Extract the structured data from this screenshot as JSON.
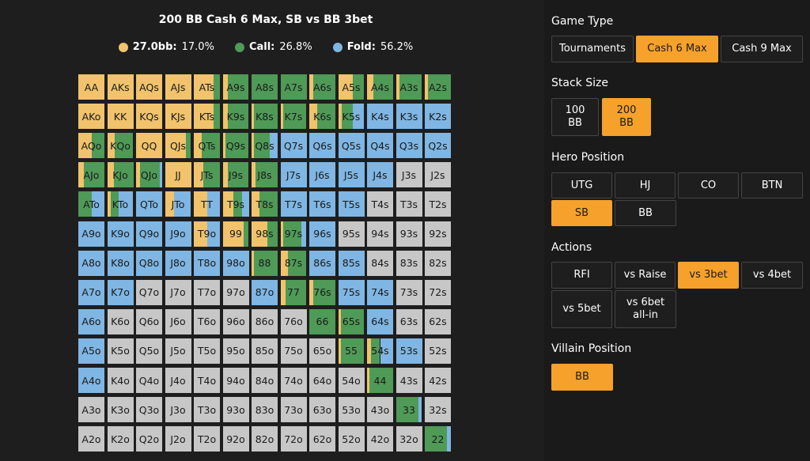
{
  "colors": {
    "raise": "#f0c36c",
    "call": "#4f9a57",
    "fold": "#7fb6e3",
    "none": "#c7c7c7",
    "accent": "#f5a12b"
  },
  "chart": {
    "title": "200 BB Cash 6 Max, SB vs BB 3bet",
    "legend": [
      {
        "label": "27.0bb:",
        "value": "17.0%",
        "color": "#f0c36c"
      },
      {
        "label": "Call:",
        "value": "26.8%",
        "color": "#4f9a57"
      },
      {
        "label": "Fold:",
        "value": "56.2%",
        "color": "#7fb6e3"
      }
    ]
  },
  "hands": [
    [
      "AA",
      "AKs",
      "AQs",
      "AJs",
      "ATs",
      "A9s",
      "A8s",
      "A7s",
      "A6s",
      "A5s",
      "A4s",
      "A3s",
      "A2s"
    ],
    [
      "AKo",
      "KK",
      "KQs",
      "KJs",
      "KTs",
      "K9s",
      "K8s",
      "K7s",
      "K6s",
      "K5s",
      "K4s",
      "K3s",
      "K2s"
    ],
    [
      "AQo",
      "KQo",
      "QQ",
      "QJs",
      "QTs",
      "Q9s",
      "Q8s",
      "Q7s",
      "Q6s",
      "Q5s",
      "Q4s",
      "Q3s",
      "Q2s"
    ],
    [
      "AJo",
      "KJo",
      "QJo",
      "JJ",
      "JTs",
      "J9s",
      "J8s",
      "J7s",
      "J6s",
      "J5s",
      "J4s",
      "J3s",
      "J2s"
    ],
    [
      "ATo",
      "KTo",
      "QTo",
      "JTo",
      "TT",
      "T9s",
      "T8s",
      "T7s",
      "T6s",
      "T5s",
      "T4s",
      "T3s",
      "T2s"
    ],
    [
      "A9o",
      "K9o",
      "Q9o",
      "J9o",
      "T9o",
      "99",
      "98s",
      "97s",
      "96s",
      "95s",
      "94s",
      "93s",
      "92s"
    ],
    [
      "A8o",
      "K8o",
      "Q8o",
      "J8o",
      "T8o",
      "98o",
      "88",
      "87s",
      "86s",
      "85s",
      "84s",
      "83s",
      "82s"
    ],
    [
      "A7o",
      "K7o",
      "Q7o",
      "J7o",
      "T7o",
      "97o",
      "87o",
      "77",
      "76s",
      "75s",
      "74s",
      "73s",
      "72s"
    ],
    [
      "A6o",
      "K6o",
      "Q6o",
      "J6o",
      "T6o",
      "96o",
      "86o",
      "76o",
      "66",
      "65s",
      "64s",
      "63s",
      "62s"
    ],
    [
      "A5o",
      "K5o",
      "Q5o",
      "J5o",
      "T5o",
      "95o",
      "85o",
      "75o",
      "65o",
      "55",
      "54s",
      "53s",
      "52s"
    ],
    [
      "A4o",
      "K4o",
      "Q4o",
      "J4o",
      "T4o",
      "94o",
      "84o",
      "74o",
      "64o",
      "54o",
      "44",
      "43s",
      "42s"
    ],
    [
      "A3o",
      "K3o",
      "Q3o",
      "J3o",
      "T3o",
      "93o",
      "83o",
      "73o",
      "63o",
      "53o",
      "43o",
      "33",
      "32s"
    ],
    [
      "A2o",
      "K2o",
      "Q2o",
      "J2o",
      "T2o",
      "92o",
      "82o",
      "72o",
      "62o",
      "52o",
      "42o",
      "32o",
      "22"
    ]
  ],
  "freqs": [
    [
      [
        1,
        0,
        0
      ],
      [
        1,
        0,
        0
      ],
      [
        1,
        0,
        0
      ],
      [
        1,
        0,
        0
      ],
      [
        0.75,
        0.25,
        0
      ],
      [
        0.2,
        0.8,
        0
      ],
      [
        0,
        1,
        0
      ],
      [
        0,
        1,
        0
      ],
      [
        0.15,
        0.85,
        0
      ],
      [
        0.55,
        0.45,
        0
      ],
      [
        0.25,
        0.75,
        0
      ],
      [
        0.15,
        0.85,
        0
      ],
      [
        0.12,
        0.88,
        0
      ]
    ],
    [
      [
        1,
        0,
        0
      ],
      [
        1,
        0,
        0
      ],
      [
        1,
        0,
        0
      ],
      [
        1,
        0,
        0
      ],
      [
        0.75,
        0.25,
        0
      ],
      [
        0.2,
        0.8,
        0
      ],
      [
        0.1,
        0.9,
        0
      ],
      [
        0.12,
        0.88,
        0
      ],
      [
        0.3,
        0.7,
        0
      ],
      [
        0.15,
        0.4,
        0.45
      ],
      [
        0,
        0,
        1
      ],
      [
        0,
        0,
        1
      ],
      [
        0,
        0,
        1
      ]
    ],
    [
      [
        0.5,
        0.5,
        0
      ],
      [
        0.3,
        0.7,
        0
      ],
      [
        1,
        0,
        0
      ],
      [
        0.8,
        0.2,
        0
      ],
      [
        0.3,
        0.7,
        0
      ],
      [
        0.1,
        0.9,
        0
      ],
      [
        0.1,
        0.6,
        0.3
      ],
      [
        0,
        0,
        1
      ],
      [
        0,
        0,
        1
      ],
      [
        0,
        0,
        1
      ],
      [
        0,
        0,
        1
      ],
      [
        0,
        0,
        1
      ],
      [
        0,
        0,
        1
      ]
    ],
    [
      [
        0.2,
        0.8,
        0
      ],
      [
        0.25,
        0.75,
        0
      ],
      [
        0.15,
        0.75,
        0.1
      ],
      [
        1,
        0,
        0
      ],
      [
        0.35,
        0.65,
        0
      ],
      [
        0.2,
        0.8,
        0
      ],
      [
        0.15,
        0.85,
        0
      ],
      [
        0,
        0,
        1
      ],
      [
        0,
        0,
        1
      ],
      [
        0,
        0,
        1
      ],
      [
        0,
        0,
        1
      ],
      [
        0,
        0,
        0
      ],
      [
        0,
        0,
        0
      ]
    ],
    [
      [
        0,
        0.5,
        0.5
      ],
      [
        0.15,
        0.3,
        0.55
      ],
      [
        0,
        0,
        1
      ],
      [
        0.35,
        0,
        0.65
      ],
      [
        0.5,
        0,
        0.5
      ],
      [
        0.4,
        0.35,
        0.25
      ],
      [
        0.3,
        0.7,
        0
      ],
      [
        0,
        0,
        1
      ],
      [
        0,
        0,
        1
      ],
      [
        0,
        0,
        1
      ],
      [
        0,
        0,
        0
      ],
      [
        0,
        0,
        0
      ],
      [
        0,
        0,
        0
      ]
    ],
    [
      [
        0,
        0,
        1
      ],
      [
        0,
        0,
        1
      ],
      [
        0,
        0,
        1
      ],
      [
        0,
        0,
        1
      ],
      [
        0.5,
        0,
        0.5
      ],
      [
        0.8,
        0.2,
        0
      ],
      [
        0.6,
        0.4,
        0
      ],
      [
        0.1,
        0.7,
        0.2
      ],
      [
        0,
        0,
        1
      ],
      [
        0,
        0,
        0
      ],
      [
        0,
        0,
        0
      ],
      [
        0,
        0,
        0
      ],
      [
        0,
        0,
        0
      ]
    ],
    [
      [
        0,
        0,
        1
      ],
      [
        0,
        0,
        1
      ],
      [
        0,
        0,
        1
      ],
      [
        0,
        0,
        1
      ],
      [
        0,
        0,
        1
      ],
      [
        0,
        0,
        1
      ],
      [
        0.1,
        0.9,
        0
      ],
      [
        0.3,
        0.7,
        0
      ],
      [
        0,
        0,
        1
      ],
      [
        0,
        0,
        1
      ],
      [
        0,
        0,
        0
      ],
      [
        0,
        0,
        0
      ],
      [
        0,
        0,
        0
      ]
    ],
    [
      [
        0,
        0,
        1
      ],
      [
        0,
        0,
        1
      ],
      [
        0,
        0,
        0
      ],
      [
        0,
        0,
        0
      ],
      [
        0,
        0,
        0
      ],
      [
        0,
        0,
        0
      ],
      [
        0,
        0,
        1
      ],
      [
        0.2,
        0.8,
        0
      ],
      [
        0.15,
        0.85,
        0
      ],
      [
        0,
        0,
        1
      ],
      [
        0,
        0,
        1
      ],
      [
        0,
        0,
        0
      ],
      [
        0,
        0,
        0
      ]
    ],
    [
      [
        0,
        0,
        1
      ],
      [
        0,
        0,
        0
      ],
      [
        0,
        0,
        0
      ],
      [
        0,
        0,
        0
      ],
      [
        0,
        0,
        0
      ],
      [
        0,
        0,
        0
      ],
      [
        0,
        0,
        0
      ],
      [
        0,
        0,
        0
      ],
      [
        0,
        1,
        0
      ],
      [
        0.1,
        0.9,
        0
      ],
      [
        0,
        0,
        1
      ],
      [
        0,
        0,
        0
      ],
      [
        0,
        0,
        0
      ]
    ],
    [
      [
        0,
        0,
        1
      ],
      [
        0,
        0,
        0
      ],
      [
        0,
        0,
        0
      ],
      [
        0,
        0,
        0
      ],
      [
        0,
        0,
        0
      ],
      [
        0,
        0,
        0
      ],
      [
        0,
        0,
        0
      ],
      [
        0,
        0,
        0
      ],
      [
        0,
        0,
        0
      ],
      [
        0.1,
        0.9,
        0
      ],
      [
        0.15,
        0.35,
        0.5
      ],
      [
        0,
        0,
        1
      ],
      [
        0,
        0,
        0
      ]
    ],
    [
      [
        0,
        0,
        1
      ],
      [
        0,
        0,
        0
      ],
      [
        0,
        0,
        0
      ],
      [
        0,
        0,
        0
      ],
      [
        0,
        0,
        0
      ],
      [
        0,
        0,
        0
      ],
      [
        0,
        0,
        0
      ],
      [
        0,
        0,
        0
      ],
      [
        0,
        0,
        0
      ],
      [
        0,
        0,
        0
      ],
      [
        0.1,
        0.9,
        0
      ],
      [
        0,
        0,
        0
      ],
      [
        0,
        0,
        0
      ]
    ],
    [
      [
        0,
        0,
        0
      ],
      [
        0,
        0,
        0
      ],
      [
        0,
        0,
        0
      ],
      [
        0,
        0,
        0
      ],
      [
        0,
        0,
        0
      ],
      [
        0,
        0,
        0
      ],
      [
        0,
        0,
        0
      ],
      [
        0,
        0,
        0
      ],
      [
        0,
        0,
        0
      ],
      [
        0,
        0,
        0
      ],
      [
        0,
        0,
        0
      ],
      [
        0,
        0.85,
        0.15
      ],
      [
        0,
        0,
        0
      ]
    ],
    [
      [
        0,
        0,
        0
      ],
      [
        0,
        0,
        0
      ],
      [
        0,
        0,
        0
      ],
      [
        0,
        0,
        0
      ],
      [
        0,
        0,
        0
      ],
      [
        0,
        0,
        0
      ],
      [
        0,
        0,
        0
      ],
      [
        0,
        0,
        0
      ],
      [
        0,
        0,
        0
      ],
      [
        0,
        0,
        0
      ],
      [
        0,
        0,
        0
      ],
      [
        0,
        0,
        0
      ],
      [
        0,
        0.85,
        0.15
      ]
    ]
  ],
  "panel": {
    "game_type": {
      "title": "Game Type",
      "options": [
        "Tournaments",
        "Cash 6 Max",
        "Cash 9 Max"
      ],
      "selected": 1
    },
    "stack_size": {
      "title": "Stack Size",
      "options": [
        "100\nBB",
        "200\nBB"
      ],
      "selected": 1
    },
    "hero_position": {
      "title": "Hero Position",
      "options": [
        "UTG",
        "HJ",
        "CO",
        "BTN",
        "SB",
        "BB"
      ],
      "selected": 4
    },
    "actions": {
      "title": "Actions",
      "options": [
        "RFI",
        "vs Raise",
        "vs 3bet",
        "vs 4bet",
        "vs 5bet",
        "vs 6bet\nall-in"
      ],
      "selected": 2
    },
    "villain_position": {
      "title": "Villain Position",
      "options": [
        "BB"
      ],
      "selected": 0
    }
  }
}
